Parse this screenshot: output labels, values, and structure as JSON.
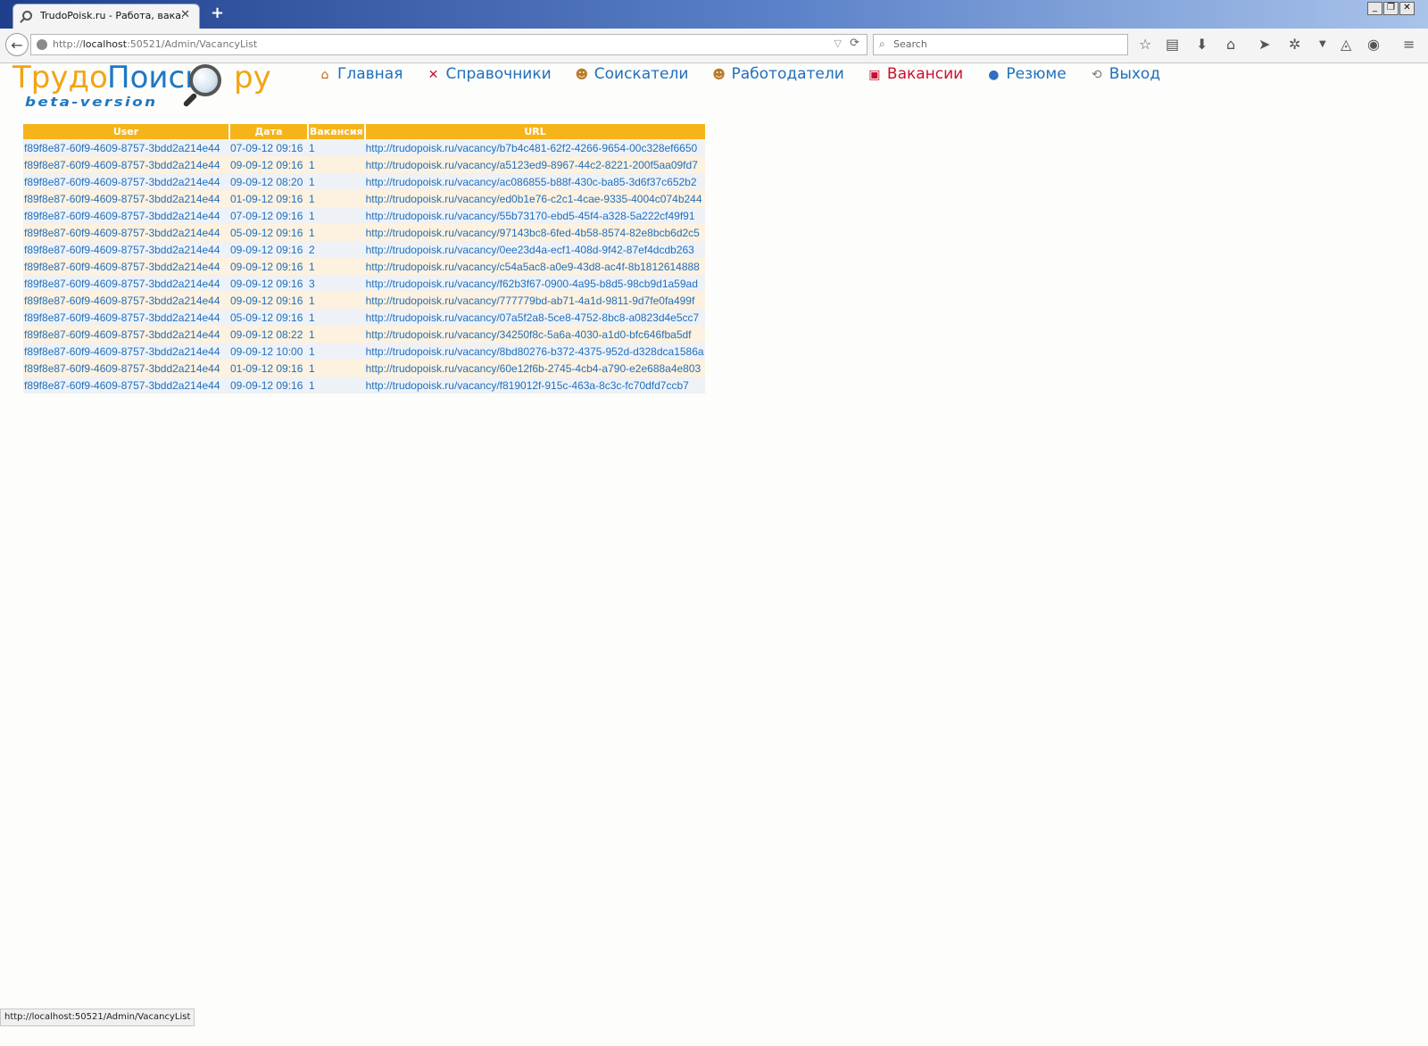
{
  "browser": {
    "tab_title": "TrudoPoisk.ru - Работа, вака...",
    "tab_close": "✕",
    "new_tab": "+",
    "window_buttons": [
      "_",
      "❐",
      "✕"
    ],
    "url_scheme": "http://",
    "url_host": "localhost",
    "url_rest": ":50521/Admin/VacancyList",
    "search_placeholder": "Search",
    "back": "←",
    "reload": "⟳",
    "dropmarker": "▽",
    "toolbar_icons": [
      "star-icon",
      "reading-list-icon",
      "download-icon",
      "home-icon",
      "send-icon",
      "extension-icon",
      "dropdown-icon",
      "sync-icon",
      "history-icon",
      "menu-icon"
    ]
  },
  "logo": {
    "part1": "Трудо",
    "part2": "Поиск",
    "part3": "ру",
    "tagline": "beta-version"
  },
  "menu": [
    {
      "label": "Главная",
      "icon": "home-icon"
    },
    {
      "label": "Справочники",
      "icon": "tools-icon"
    },
    {
      "label": "Соискатели",
      "icon": "people-icon"
    },
    {
      "label": "Работодатели",
      "icon": "people-icon"
    },
    {
      "label": "Вакансии",
      "icon": "vacancy-icon",
      "active": true
    },
    {
      "label": "Резюме",
      "icon": "resume-icon"
    },
    {
      "label": "Выход",
      "icon": "exit-icon"
    }
  ],
  "table": {
    "headers": [
      "User",
      "Дата",
      "Вакансия",
      "URL"
    ],
    "rows": [
      {
        "user": "f89f8e87-60f9-4609-8757-3bdd2a214e44",
        "date": "07-09-12 09:16",
        "vacancy": "1",
        "url": "http://trudopoisk.ru/vacancy/b7b4c481-62f2-4266-9654-00c328ef6650"
      },
      {
        "user": "f89f8e87-60f9-4609-8757-3bdd2a214e44",
        "date": "09-09-12 09:16",
        "vacancy": "1",
        "url": "http://trudopoisk.ru/vacancy/a5123ed9-8967-44c2-8221-200f5aa09fd7"
      },
      {
        "user": "f89f8e87-60f9-4609-8757-3bdd2a214e44",
        "date": "09-09-12 08:20",
        "vacancy": "1",
        "url": "http://trudopoisk.ru/vacancy/ac086855-b88f-430c-ba85-3d6f37c652b2"
      },
      {
        "user": "f89f8e87-60f9-4609-8757-3bdd2a214e44",
        "date": "01-09-12 09:16",
        "vacancy": "1",
        "url": "http://trudopoisk.ru/vacancy/ed0b1e76-c2c1-4cae-9335-4004c074b244"
      },
      {
        "user": "f89f8e87-60f9-4609-8757-3bdd2a214e44",
        "date": "07-09-12 09:16",
        "vacancy": "1",
        "url": "http://trudopoisk.ru/vacancy/55b73170-ebd5-45f4-a328-5a222cf49f91"
      },
      {
        "user": "f89f8e87-60f9-4609-8757-3bdd2a214e44",
        "date": "05-09-12 09:16",
        "vacancy": "1",
        "url": "http://trudopoisk.ru/vacancy/97143bc8-6fed-4b58-8574-82e8bcb6d2c5"
      },
      {
        "user": "f89f8e87-60f9-4609-8757-3bdd2a214e44",
        "date": "09-09-12 09:16",
        "vacancy": "2",
        "url": "http://trudopoisk.ru/vacancy/0ee23d4a-ecf1-408d-9f42-87ef4dcdb263"
      },
      {
        "user": "f89f8e87-60f9-4609-8757-3bdd2a214e44",
        "date": "09-09-12 09:16",
        "vacancy": "1",
        "url": "http://trudopoisk.ru/vacancy/c54a5ac8-a0e9-43d8-ac4f-8b1812614888"
      },
      {
        "user": "f89f8e87-60f9-4609-8757-3bdd2a214e44",
        "date": "09-09-12 09:16",
        "vacancy": "3",
        "url": "http://trudopoisk.ru/vacancy/f62b3f67-0900-4a95-b8d5-98cb9d1a59ad"
      },
      {
        "user": "f89f8e87-60f9-4609-8757-3bdd2a214e44",
        "date": "09-09-12 09:16",
        "vacancy": "1",
        "url": "http://trudopoisk.ru/vacancy/777779bd-ab71-4a1d-9811-9d7fe0fa499f"
      },
      {
        "user": "f89f8e87-60f9-4609-8757-3bdd2a214e44",
        "date": "05-09-12 09:16",
        "vacancy": "1",
        "url": "http://trudopoisk.ru/vacancy/07a5f2a8-5ce8-4752-8bc8-a0823d4e5cc7"
      },
      {
        "user": "f89f8e87-60f9-4609-8757-3bdd2a214e44",
        "date": "09-09-12 08:22",
        "vacancy": "1",
        "url": "http://trudopoisk.ru/vacancy/34250f8c-5a6a-4030-a1d0-bfc646fba5df"
      },
      {
        "user": "f89f8e87-60f9-4609-8757-3bdd2a214e44",
        "date": "09-09-12 10:00",
        "vacancy": "1",
        "url": "http://trudopoisk.ru/vacancy/8bd80276-b372-4375-952d-d328dca1586a"
      },
      {
        "user": "f89f8e87-60f9-4609-8757-3bdd2a214e44",
        "date": "01-09-12 09:16",
        "vacancy": "1",
        "url": "http://trudopoisk.ru/vacancy/60e12f6b-2745-4cb4-a790-e2e688a4e803"
      },
      {
        "user": "f89f8e87-60f9-4609-8757-3bdd2a214e44",
        "date": "09-09-12 09:16",
        "vacancy": "1",
        "url": "http://trudopoisk.ru/vacancy/f819012f-915c-463a-8c3c-fc70dfd7ccb7"
      }
    ]
  },
  "statusbar": "http://localhost:50521/Admin/VacancyList",
  "colors": {
    "accent_orange": "#f6b41a",
    "link_blue": "#1f6fbd",
    "active_red": "#c8102e"
  }
}
